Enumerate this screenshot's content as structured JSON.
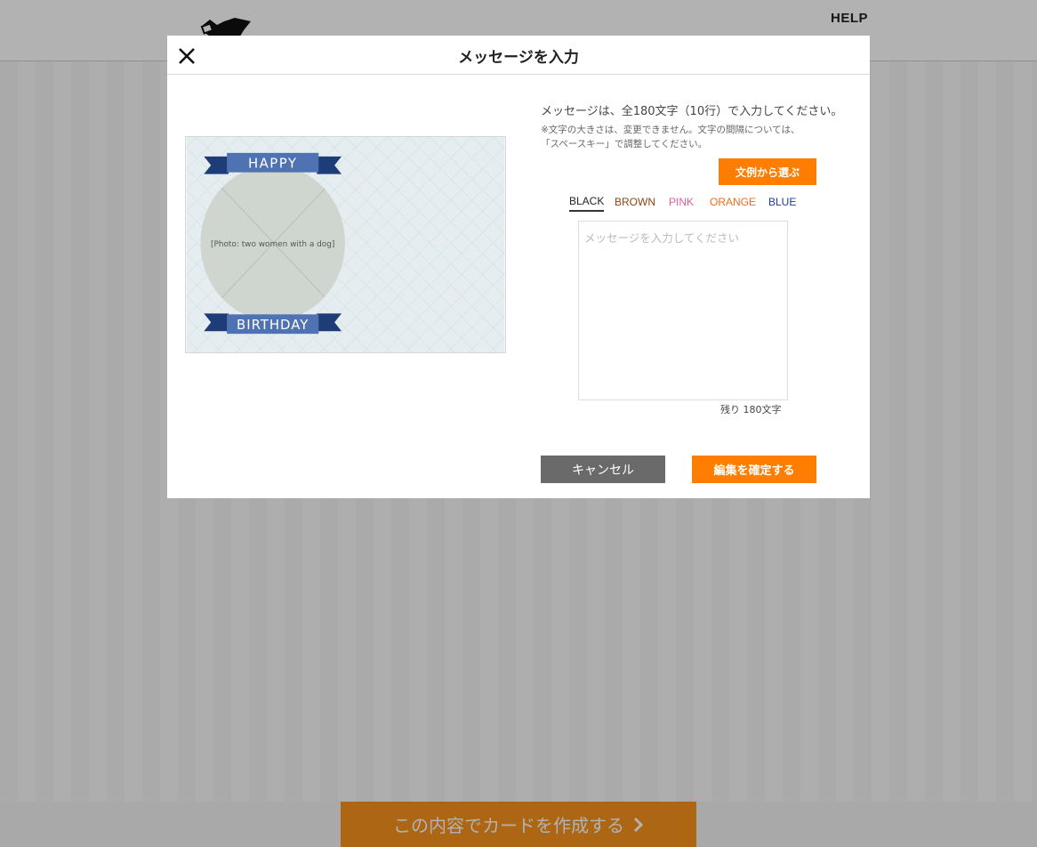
{
  "header": {
    "help_label": "HELP"
  },
  "footer": {
    "create_label": "この内容でカードを作成する",
    "arrow_icon": "chevron-right-icon"
  },
  "modal": {
    "title": "メッセージを入力",
    "close_icon": "close-icon",
    "instruction": "メッセージは、全180文字（10行）で入力してください。",
    "note": "※文字の大きさは、変更できません。文字の間隔については、「スペースキー」で調整してください。",
    "examples_button": "文例から選ぶ",
    "color_tabs": [
      {
        "label": "BLACK",
        "color": "#222222",
        "active": true
      },
      {
        "label": "BROWN",
        "color": "#8b4513",
        "active": false
      },
      {
        "label": "PINK",
        "color": "#e75b9c",
        "active": false
      },
      {
        "label": "ORANGE",
        "color": "#ef6c1e",
        "active": false
      },
      {
        "label": "BLUE",
        "color": "#1f3d9c",
        "active": false
      }
    ],
    "message_placeholder": "メッセージを入力してください",
    "message_value": "",
    "remaining_label": "残り 180文字",
    "cancel_button": "キャンセル",
    "confirm_button": "編集を確定する",
    "card_preview": {
      "banner_top": "HAPPY",
      "banner_bottom": "BIRTHDAY",
      "photo_label": "[Photo: two women with a dog]"
    }
  },
  "colors": {
    "accent": "#ff7d00",
    "cancel": "#6a6a6a"
  }
}
